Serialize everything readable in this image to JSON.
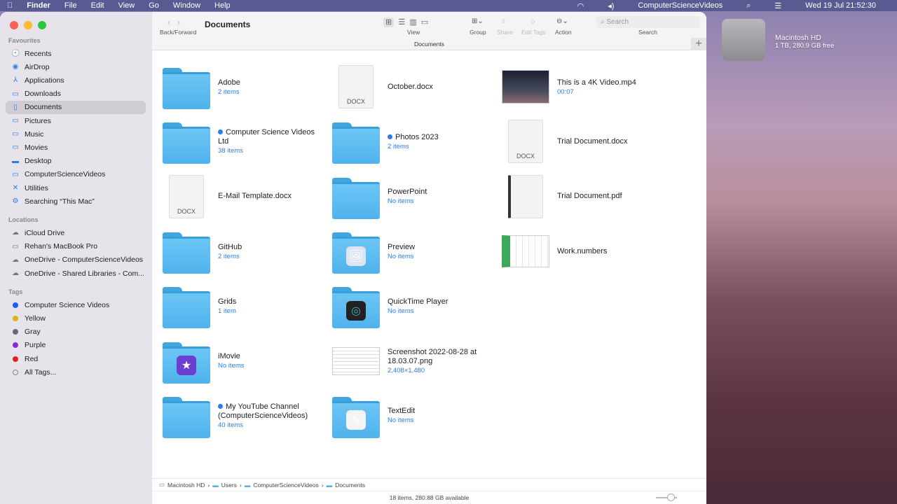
{
  "menubar": {
    "app": "Finder",
    "items": [
      "File",
      "Edit",
      "View",
      "Go",
      "Window",
      "Help"
    ],
    "user": "ComputerScienceVideos",
    "datetime": "Wed 19 Jul  21:52:30"
  },
  "toolbar": {
    "back_forward": "Back/Forward",
    "title": "Documents",
    "view": "View",
    "group": "Group",
    "share": "Share",
    "edit_tags": "Edit Tags",
    "action": "Action",
    "search_placeholder": "Search",
    "search": "Search",
    "tab": "Documents"
  },
  "sidebar": {
    "favourites_label": "Favourites",
    "favourites": [
      {
        "label": "Recents",
        "icon": "🕘"
      },
      {
        "label": "AirDrop",
        "icon": "◉"
      },
      {
        "label": "Applications",
        "icon": "⅄"
      },
      {
        "label": "Downloads",
        "icon": "▭"
      },
      {
        "label": "Documents",
        "icon": "▯"
      },
      {
        "label": "Pictures",
        "icon": "▭"
      },
      {
        "label": "Music",
        "icon": "▭"
      },
      {
        "label": "Movies",
        "icon": "▭"
      },
      {
        "label": "Desktop",
        "icon": "▬"
      },
      {
        "label": "ComputerScienceVideos",
        "icon": "▭"
      },
      {
        "label": "Utilities",
        "icon": "✕"
      },
      {
        "label": "Searching “This Mac”",
        "icon": "⚙"
      }
    ],
    "locations_label": "Locations",
    "locations": [
      {
        "label": "iCloud Drive",
        "icon": "☁"
      },
      {
        "label": "Rehan's MacBook Pro",
        "icon": "▭"
      },
      {
        "label": "OneDrive - ComputerScienceVideos",
        "icon": "☁"
      },
      {
        "label": "OneDrive - Shared Libraries - Com...",
        "icon": "☁"
      }
    ],
    "tags_label": "Tags",
    "tags": [
      {
        "label": "Computer Science Videos",
        "color": "#1a5ff0"
      },
      {
        "label": "Yellow",
        "color": "#e0b21a"
      },
      {
        "label": "Gray",
        "color": "#666a70"
      },
      {
        "label": "Purple",
        "color": "#8a2bd0"
      },
      {
        "label": "Red",
        "color": "#e02020"
      },
      {
        "label": "All Tags...",
        "color": ""
      }
    ]
  },
  "files": [
    {
      "name": "Adobe",
      "sub": "2 items",
      "kind": "folder"
    },
    {
      "name": "Computer Science Videos Ltd",
      "sub": "38 items",
      "kind": "folder",
      "tag": true
    },
    {
      "name": "E-Mail Template.docx",
      "sub": "",
      "kind": "docx",
      "label": "DOCX"
    },
    {
      "name": "GitHub",
      "sub": "2 items",
      "kind": "folder"
    },
    {
      "name": "Grids",
      "sub": "1 item",
      "kind": "folder"
    },
    {
      "name": "iMovie",
      "sub": "No items",
      "kind": "folder",
      "badge": "★",
      "badgeColor": "#6b3fd0"
    },
    {
      "name": "My YouTube Channel (ComputerScienceVideos)",
      "sub": "40 items",
      "kind": "folder",
      "tag": true
    },
    {
      "name": "October.docx",
      "sub": "",
      "kind": "docx",
      "label": "DOCX"
    },
    {
      "name": "Photos 2023",
      "sub": "2 items",
      "kind": "folder",
      "tag": true
    },
    {
      "name": "PowerPoint",
      "sub": "No items",
      "kind": "folder"
    },
    {
      "name": "Preview",
      "sub": "No items",
      "kind": "folder",
      "badge": "🖼",
      "badgeColor": "#dde6f0"
    },
    {
      "name": "QuickTime Player",
      "sub": "No items",
      "kind": "folder",
      "badge": "◎",
      "badgeColor": "#222"
    },
    {
      "name": "Screenshot 2022-08-28 at 18.03.07.png",
      "sub": "2,408×1,480",
      "kind": "image"
    },
    {
      "name": "TextEdit",
      "sub": "No items",
      "kind": "folder",
      "badge": "✎",
      "badgeColor": "#f4f4f4"
    },
    {
      "name": "This is a 4K Video.mp4",
      "sub": "00:07",
      "kind": "video"
    },
    {
      "name": "Trial Document.docx",
      "sub": "",
      "kind": "docx",
      "label": "DOCX"
    },
    {
      "name": "Trial Document.pdf",
      "sub": "",
      "kind": "pdf"
    },
    {
      "name": "Work.numbers",
      "sub": "",
      "kind": "numbers"
    }
  ],
  "pathbar": [
    "Macintosh HD",
    "Users",
    "ComputerScienceVideos",
    "Documents"
  ],
  "status": "18 items, 280.88 GB available",
  "desktop": {
    "disk_name": "Macintosh HD",
    "disk_info": "1 TB, 280.9 GB free"
  }
}
